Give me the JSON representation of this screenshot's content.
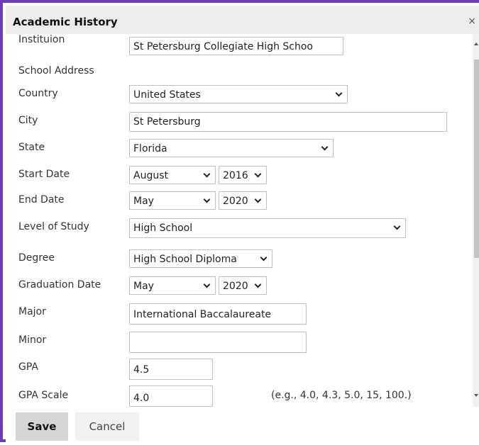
{
  "dialog": {
    "title": "Academic History",
    "close_icon": "close-icon"
  },
  "fields": {
    "institution": {
      "label": "Instituion",
      "value": "St Petersburg Collegiate High Schoo"
    },
    "school_address": {
      "label": "School Address"
    },
    "country": {
      "label": "Country",
      "value": "United States"
    },
    "city": {
      "label": "City",
      "value": "St Petersburg"
    },
    "state": {
      "label": "State",
      "value": "Florida"
    },
    "start_date": {
      "label": "Start Date",
      "month": "August",
      "year": "2016"
    },
    "end_date": {
      "label": "End Date",
      "month": "May",
      "year": "2020"
    },
    "level_of_study": {
      "label": "Level of Study",
      "value": "High School"
    },
    "degree": {
      "label": "Degree",
      "value": "High School Diploma"
    },
    "graduation_date": {
      "label": "Graduation Date",
      "month": "May",
      "year": "2020"
    },
    "major": {
      "label": "Major",
      "value": "International Baccalaureate"
    },
    "minor": {
      "label": "Minor",
      "value": ""
    },
    "gpa": {
      "label": "GPA",
      "value": "4.5"
    },
    "gpa_scale": {
      "label": "GPA Scale",
      "value": "4.0",
      "hint": "(e.g., 4.0, 4.3, 5.0, 15, 100.)"
    }
  },
  "footer": {
    "save_label": "Save",
    "cancel_label": "Cancel"
  }
}
